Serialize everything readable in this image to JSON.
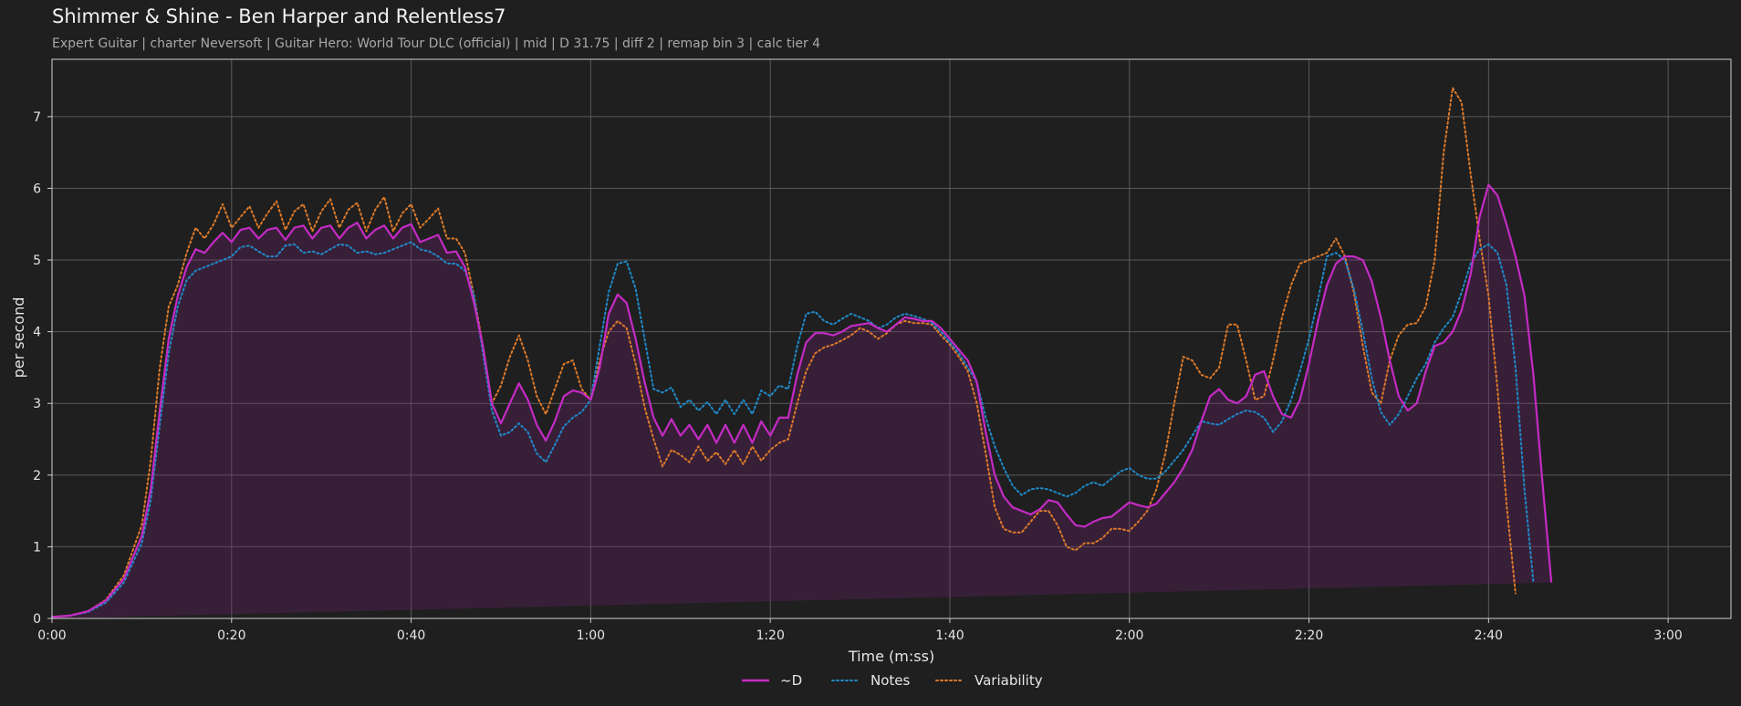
{
  "header": {
    "title": "Shimmer & Shine - Ben Harper and Relentless7",
    "subtitle": "Expert Guitar  |  charter Neversoft  |  Guitar Hero: World Tour DLC (official)  |  mid  |  D 31.75  |  diff 2  |  remap bin 3  |  calc tier 4"
  },
  "colors": {
    "D": "#c42bc4",
    "Notes": "#1f8ac9",
    "Variability": "#dd7a2a",
    "background": "#1f1f1f",
    "grid": "#5a5a5a"
  },
  "chart_data": {
    "type": "line",
    "title": "Shimmer & Shine - Ben Harper and Relentless7",
    "xlabel": "Time (m:ss)",
    "ylabel": "per second",
    "xlim": [
      0,
      187
    ],
    "ylim": [
      0,
      7.8
    ],
    "xticks": [
      0,
      20,
      40,
      60,
      80,
      100,
      120,
      140,
      160,
      180
    ],
    "xtick_labels": [
      "0:00",
      "0:20",
      "0:40",
      "1:00",
      "1:20",
      "1:40",
      "2:00",
      "2:20",
      "2:40",
      "3:00"
    ],
    "yticks": [
      0,
      1,
      2,
      3,
      4,
      5,
      6,
      7
    ],
    "ytick_labels": [
      "0",
      "1",
      "2",
      "3",
      "4",
      "5",
      "6",
      "7"
    ],
    "grid": true,
    "legend_position": "bottom-center",
    "x": [
      0,
      2,
      4,
      6,
      8,
      10,
      11,
      12,
      13,
      14,
      15,
      16,
      17,
      18,
      19,
      20,
      21,
      22,
      23,
      24,
      25,
      26,
      27,
      28,
      29,
      30,
      31,
      32,
      33,
      34,
      35,
      36,
      37,
      38,
      39,
      40,
      41,
      42,
      43,
      44,
      45,
      46,
      47,
      48,
      49,
      50,
      51,
      52,
      53,
      54,
      55,
      56,
      57,
      58,
      59,
      60,
      61,
      62,
      63,
      64,
      65,
      66,
      67,
      68,
      69,
      70,
      71,
      72,
      73,
      74,
      75,
      76,
      77,
      78,
      79,
      80,
      81,
      82,
      83,
      84,
      85,
      86,
      87,
      88,
      89,
      90,
      91,
      92,
      93,
      94,
      95,
      96,
      97,
      98,
      99,
      100,
      101,
      102,
      103,
      104,
      105,
      106,
      107,
      108,
      109,
      110,
      111,
      112,
      113,
      114,
      115,
      116,
      117,
      118,
      119,
      120,
      121,
      122,
      123,
      124,
      125,
      126,
      127,
      128,
      129,
      130,
      131,
      132,
      133,
      134,
      135,
      136,
      137,
      138,
      139,
      140,
      141,
      142,
      143,
      144,
      145,
      146,
      147,
      148,
      149,
      150,
      151,
      152,
      153,
      154,
      155,
      156,
      157,
      158,
      159,
      160,
      161,
      162,
      163,
      164,
      165,
      166,
      167,
      168,
      169,
      170,
      171,
      172,
      173,
      174,
      175,
      176,
      177,
      178,
      179,
      180,
      181,
      182,
      183,
      184,
      185,
      186,
      187
    ],
    "series": [
      {
        "name": "~D",
        "style": "solid",
        "values": [
          0.02,
          0.04,
          0.1,
          0.25,
          0.55,
          1.15,
          1.8,
          2.9,
          3.9,
          4.5,
          4.9,
          5.15,
          5.1,
          5.25,
          5.38,
          5.25,
          5.42,
          5.45,
          5.3,
          5.42,
          5.45,
          5.28,
          5.45,
          5.48,
          5.3,
          5.45,
          5.48,
          5.3,
          5.45,
          5.52,
          5.3,
          5.42,
          5.48,
          5.3,
          5.45,
          5.5,
          5.25,
          5.3,
          5.35,
          5.1,
          5.12,
          4.9,
          4.4,
          3.8,
          3.0,
          2.72,
          3.0,
          3.28,
          3.05,
          2.7,
          2.48,
          2.75,
          3.1,
          3.18,
          3.15,
          3.05,
          3.5,
          4.25,
          4.52,
          4.4,
          3.9,
          3.3,
          2.8,
          2.55,
          2.78,
          2.55,
          2.7,
          2.5,
          2.7,
          2.45,
          2.7,
          2.45,
          2.7,
          2.45,
          2.75,
          2.55,
          2.8,
          2.8,
          3.4,
          3.85,
          3.98,
          3.98,
          3.95,
          4.0,
          4.08,
          4.1,
          4.12,
          4.05,
          4.0,
          4.1,
          4.2,
          4.18,
          4.15,
          4.15,
          4.05,
          3.9,
          3.75,
          3.6,
          3.3,
          2.6,
          2.0,
          1.7,
          1.55,
          1.5,
          1.45,
          1.52,
          1.65,
          1.62,
          1.45,
          1.3,
          1.28,
          1.35,
          1.4,
          1.42,
          1.52,
          1.62,
          1.58,
          1.55,
          1.6,
          1.75,
          1.9,
          2.1,
          2.35,
          2.75,
          3.1,
          3.2,
          3.05,
          3.0,
          3.1,
          3.4,
          3.45,
          3.1,
          2.85,
          2.8,
          3.05,
          3.55,
          4.15,
          4.65,
          4.95,
          5.05,
          5.05,
          5.0,
          4.7,
          4.2,
          3.6,
          3.1,
          2.9,
          3.0,
          3.45,
          3.8,
          3.85,
          4.0,
          4.3,
          4.8,
          5.6,
          6.05,
          5.9,
          5.5,
          5.05,
          4.5,
          3.4,
          1.9,
          0.5
        ]
      },
      {
        "name": "Notes",
        "style": "dotted",
        "values": [
          0.02,
          0.04,
          0.09,
          0.22,
          0.5,
          1.05,
          1.65,
          2.7,
          3.7,
          4.35,
          4.72,
          4.85,
          4.9,
          4.95,
          5.0,
          5.05,
          5.18,
          5.2,
          5.12,
          5.05,
          5.05,
          5.2,
          5.22,
          5.1,
          5.12,
          5.08,
          5.15,
          5.22,
          5.2,
          5.1,
          5.12,
          5.08,
          5.1,
          5.15,
          5.2,
          5.25,
          5.15,
          5.12,
          5.05,
          4.95,
          4.95,
          4.85,
          4.5,
          3.7,
          2.9,
          2.55,
          2.6,
          2.72,
          2.6,
          2.3,
          2.18,
          2.42,
          2.68,
          2.8,
          2.88,
          3.05,
          3.8,
          4.55,
          4.95,
          4.98,
          4.6,
          3.9,
          3.2,
          3.15,
          3.22,
          2.95,
          3.05,
          2.9,
          3.02,
          2.85,
          3.05,
          2.85,
          3.05,
          2.85,
          3.18,
          3.1,
          3.25,
          3.2,
          3.8,
          4.25,
          4.28,
          4.15,
          4.1,
          4.18,
          4.25,
          4.2,
          4.15,
          4.05,
          4.1,
          4.2,
          4.25,
          4.22,
          4.18,
          4.12,
          4.0,
          3.85,
          3.7,
          3.5,
          3.3,
          2.8,
          2.4,
          2.1,
          1.85,
          1.72,
          1.8,
          1.82,
          1.8,
          1.75,
          1.7,
          1.75,
          1.85,
          1.9,
          1.85,
          1.95,
          2.05,
          2.1,
          2.0,
          1.95,
          1.95,
          2.05,
          2.2,
          2.35,
          2.55,
          2.75,
          2.72,
          2.7,
          2.78,
          2.85,
          2.9,
          2.88,
          2.8,
          2.6,
          2.75,
          3.05,
          3.45,
          3.9,
          4.45,
          5.05,
          5.1,
          5.0,
          4.6,
          4.0,
          3.35,
          2.88,
          2.7,
          2.85,
          3.1,
          3.35,
          3.55,
          3.85,
          4.05,
          4.2,
          4.55,
          4.95,
          5.15,
          5.22,
          5.1,
          4.65,
          3.5,
          1.8,
          0.5
        ]
      },
      {
        "name": "Variability",
        "style": "dotted",
        "values": [
          0.02,
          0.04,
          0.1,
          0.26,
          0.6,
          1.3,
          2.2,
          3.5,
          4.35,
          4.65,
          5.1,
          5.45,
          5.3,
          5.5,
          5.78,
          5.45,
          5.6,
          5.75,
          5.45,
          5.65,
          5.82,
          5.42,
          5.68,
          5.78,
          5.4,
          5.68,
          5.85,
          5.45,
          5.7,
          5.8,
          5.4,
          5.7,
          5.88,
          5.4,
          5.65,
          5.78,
          5.45,
          5.58,
          5.72,
          5.3,
          5.3,
          5.1,
          4.5,
          3.8,
          3.0,
          3.25,
          3.65,
          3.95,
          3.6,
          3.1,
          2.85,
          3.2,
          3.55,
          3.6,
          3.2,
          3.05,
          3.6,
          4.0,
          4.15,
          4.05,
          3.55,
          2.95,
          2.5,
          2.12,
          2.35,
          2.28,
          2.18,
          2.4,
          2.2,
          2.32,
          2.15,
          2.35,
          2.15,
          2.4,
          2.2,
          2.35,
          2.45,
          2.5,
          3.0,
          3.45,
          3.7,
          3.78,
          3.82,
          3.88,
          3.95,
          4.05,
          4.0,
          3.9,
          3.98,
          4.1,
          4.15,
          4.12,
          4.12,
          4.1,
          3.95,
          3.82,
          3.65,
          3.45,
          3.0,
          2.3,
          1.55,
          1.25,
          1.2,
          1.2,
          1.35,
          1.5,
          1.5,
          1.3,
          1.0,
          0.95,
          1.05,
          1.05,
          1.12,
          1.25,
          1.25,
          1.22,
          1.35,
          1.5,
          1.8,
          2.3,
          3.0,
          3.65,
          3.6,
          3.4,
          3.35,
          3.5,
          4.1,
          4.1,
          3.6,
          3.05,
          3.1,
          3.6,
          4.2,
          4.65,
          4.95,
          5.0,
          5.05,
          5.1,
          5.3,
          5.05,
          4.55,
          3.8,
          3.15,
          3.0,
          3.6,
          3.95,
          4.1,
          4.12,
          4.35,
          5.0,
          6.5,
          7.4,
          7.2,
          6.2,
          5.3,
          4.5,
          3.2,
          1.6,
          0.35
        ]
      }
    ]
  },
  "legend": [
    {
      "label": "~D",
      "style": "solid",
      "color": "#c42bc4"
    },
    {
      "label": "Notes",
      "style": "dotted",
      "color": "#1f8ac9"
    },
    {
      "label": "Variability",
      "style": "dotted",
      "color": "#dd7a2a"
    }
  ]
}
